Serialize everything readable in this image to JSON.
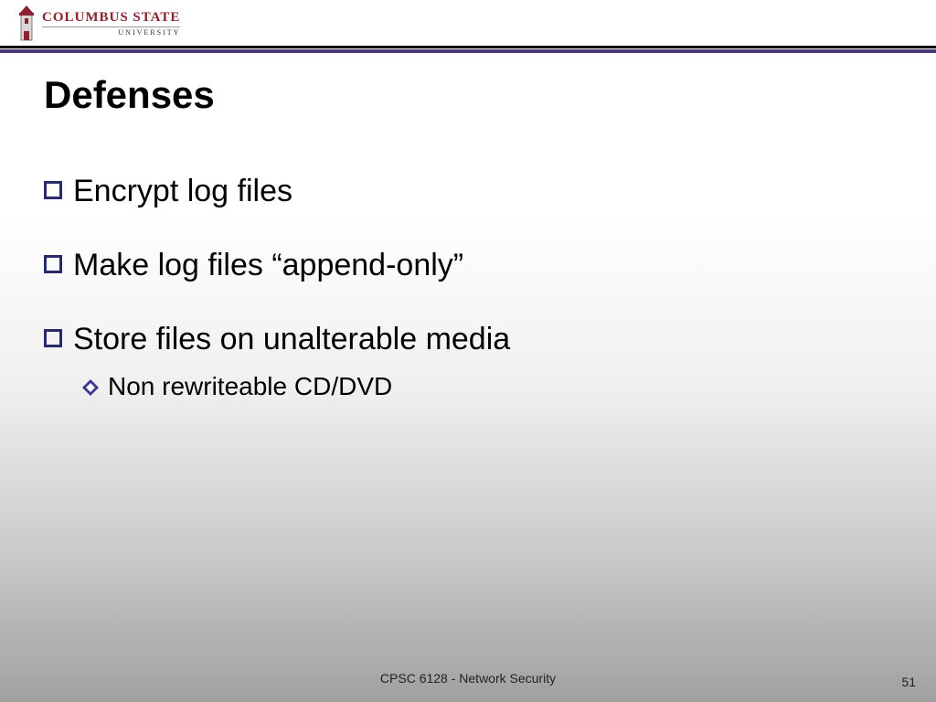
{
  "logo": {
    "line1": "COLUMBUS STATE",
    "line2": "UNIVERSITY"
  },
  "title": "Defenses",
  "bullets": [
    {
      "text": "Encrypt log files"
    },
    {
      "text": "Make log files “append-only”"
    },
    {
      "text": "Store files on unalterable media",
      "sub": [
        {
          "text": " Non rewriteable CD/DVD"
        }
      ]
    }
  ],
  "footer": "CPSC 6128 - Network Security",
  "page_number": "51",
  "colors": {
    "brand_red": "#8a2230",
    "divider_purple": "#4a3a7a",
    "bullet_outline": "#2a2a6a"
  }
}
